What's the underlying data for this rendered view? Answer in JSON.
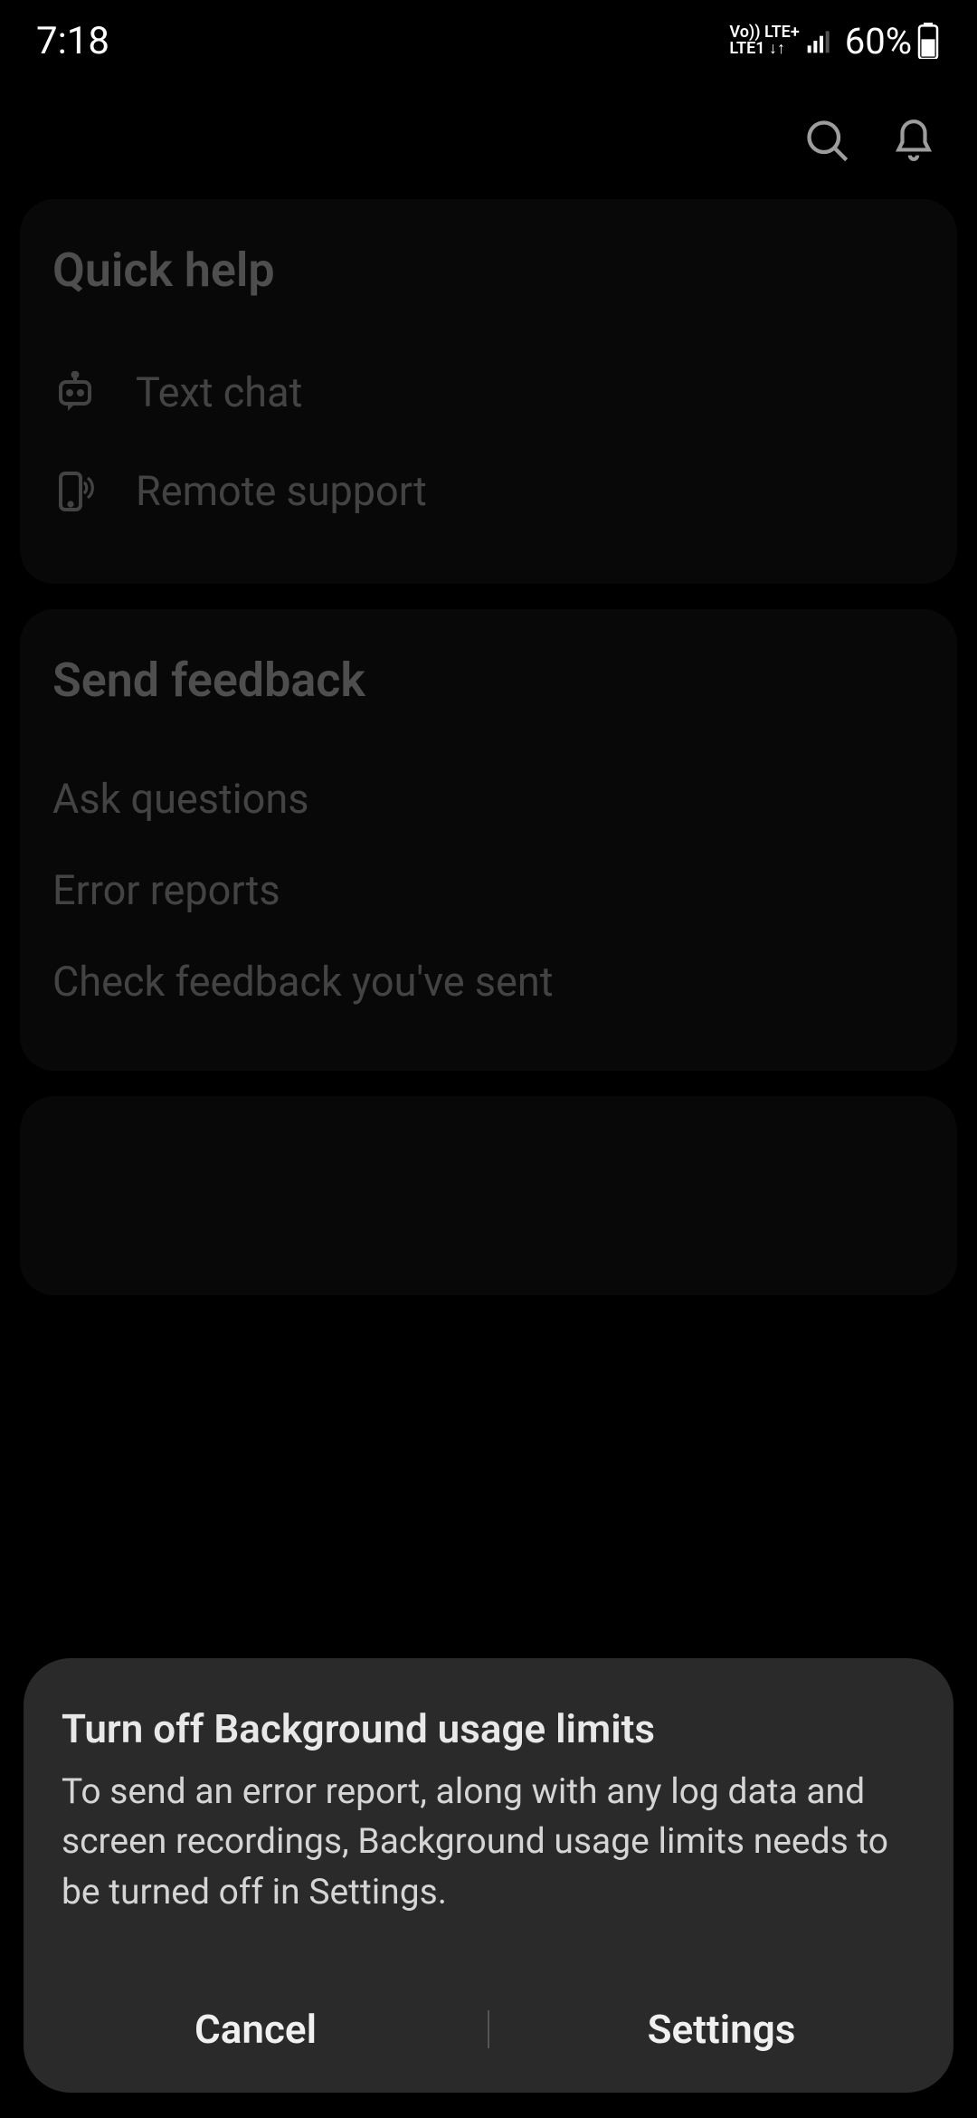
{
  "status": {
    "time": "7:18",
    "net_top": "Vo))  LTE+",
    "net_bottom": "LTE1 ↓↑",
    "battery_pct": "60%"
  },
  "sections": {
    "quick_help": {
      "title": "Quick help",
      "text_chat": "Text chat",
      "remote_support": "Remote support"
    },
    "send_feedback": {
      "title": "Send feedback",
      "ask_questions": "Ask questions",
      "error_reports": "Error reports",
      "check_feedback": "Check feedback you've sent"
    }
  },
  "dialog": {
    "title": "Turn off Background usage limits",
    "body": "To send an error report, along with any log data and screen recordings, Background usage limits needs to be turned off in Settings.",
    "cancel": "Cancel",
    "settings": "Settings"
  }
}
